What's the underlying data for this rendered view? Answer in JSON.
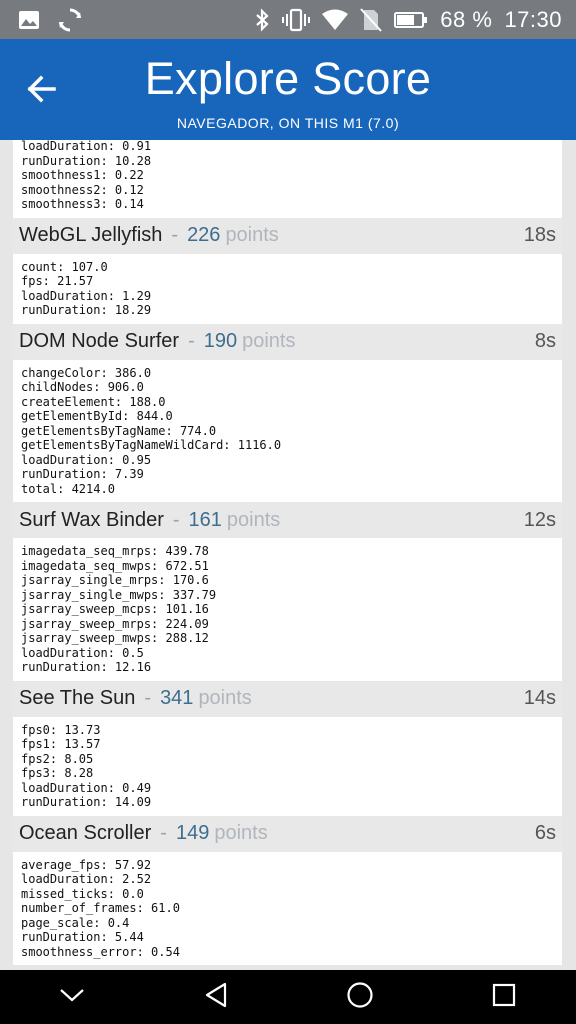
{
  "status_bar": {
    "icons": [
      "image-icon",
      "sync-icon",
      "bluetooth-icon",
      "vibrate-icon",
      "wifi-icon",
      "no-sim-icon",
      "battery-icon"
    ],
    "battery": "68 %",
    "time": "17:30"
  },
  "app_bar": {
    "title": "Explore Score",
    "subtitle": "NAVEGADOR, ON THIS M1 (7.0)",
    "back_icon": "arrow-back-icon",
    "color": "#1766bb"
  },
  "sections": [
    {
      "details": [
        "loadDuration: 0.91",
        "runDuration: 10.28",
        "smoothness1: 0.22",
        "smoothness2: 0.12",
        "smoothness3: 0.14"
      ]
    },
    {
      "name": "WebGL Jellyfish",
      "score": "226",
      "points_label": "points",
      "time": "18s",
      "details": [
        "count: 107.0",
        "fps: 21.57",
        "loadDuration: 1.29",
        "runDuration: 18.29"
      ]
    },
    {
      "name": "DOM Node Surfer",
      "score": "190",
      "points_label": "points",
      "time": "8s",
      "details": [
        "changeColor: 386.0",
        "childNodes: 906.0",
        "createElement: 188.0",
        "getElementById: 844.0",
        "getElementsByTagName: 774.0",
        "getElementsByTagNameWildCard: 1116.0",
        "loadDuration: 0.95",
        "runDuration: 7.39",
        "total: 4214.0"
      ]
    },
    {
      "name": "Surf Wax Binder",
      "score": "161",
      "points_label": "points",
      "time": "12s",
      "details": [
        "imagedata_seq_mrps: 439.78",
        "imagedata_seq_mwps: 672.51",
        "jsarray_single_mrps: 170.6",
        "jsarray_single_mwps: 337.79",
        "jsarray_sweep_mcps: 101.16",
        "jsarray_sweep_mrps: 224.09",
        "jsarray_sweep_mwps: 288.12",
        "loadDuration: 0.5",
        "runDuration: 12.16"
      ]
    },
    {
      "name": "See The Sun",
      "score": "341",
      "points_label": "points",
      "time": "14s",
      "details": [
        "fps0: 13.73",
        "fps1: 13.57",
        "fps2: 8.05",
        "fps3: 8.28",
        "loadDuration: 0.49",
        "runDuration: 14.09"
      ]
    },
    {
      "name": "Ocean Scroller",
      "score": "149",
      "points_label": "points",
      "time": "6s",
      "details": [
        "average_fps: 57.92",
        "loadDuration: 2.52",
        "missed_ticks: 0.0",
        "number_of_frames: 61.0",
        "page_scale: 0.4",
        "runDuration: 5.44",
        "smoothness_error: 0.54"
      ]
    }
  ],
  "nav_bar": {
    "buttons": [
      "chevron-down-icon",
      "back-triangle-icon",
      "home-circle-icon",
      "recents-square-icon"
    ]
  }
}
